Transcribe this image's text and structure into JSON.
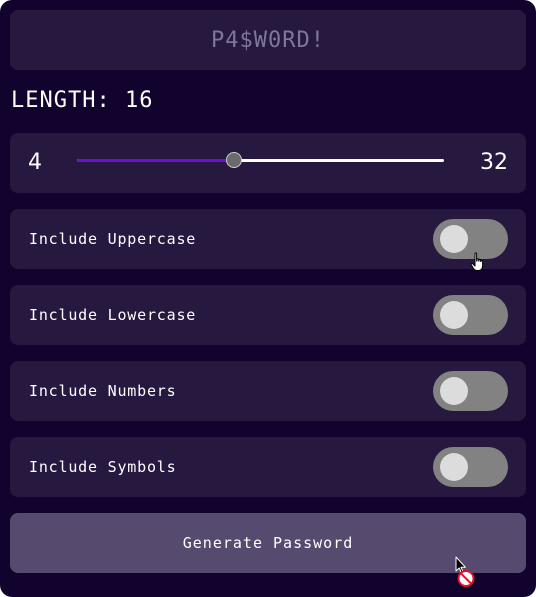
{
  "password_display": {
    "value": "P4$W0RD!"
  },
  "length": {
    "label": "LENGTH: 16",
    "value": 16,
    "min": 4,
    "max": 32,
    "min_label": "4",
    "max_label": "32"
  },
  "options": [
    {
      "label": "Include Uppercase",
      "enabled": false
    },
    {
      "label": "Include Lowercase",
      "enabled": false
    },
    {
      "label": "Include Numbers",
      "enabled": false
    },
    {
      "label": "Include Symbols",
      "enabled": false
    }
  ],
  "generate_button": {
    "label": "Generate Password"
  },
  "colors": {
    "background": "#12032e",
    "panel": "#26183f",
    "accent": "#6a10d0",
    "button": "#564a6e",
    "toggle_off": "#828282"
  },
  "icons": {
    "hand_cursor": "pointer-hand-icon",
    "not_allowed_cursor": "not-allowed-icon"
  }
}
